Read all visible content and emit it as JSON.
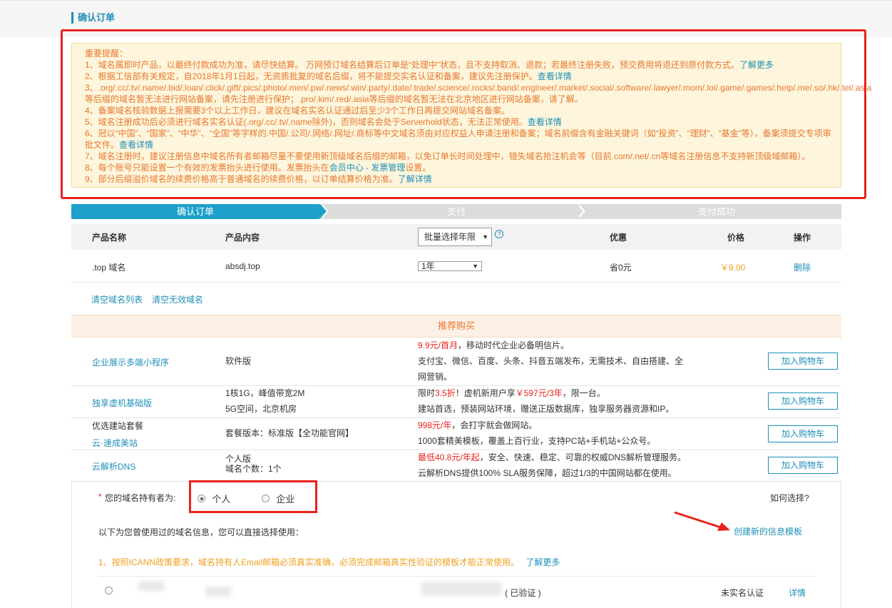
{
  "page": {
    "title": "确认订单"
  },
  "notice": {
    "heading": "重要提醒：",
    "lines": [
      {
        "text": "1、域名属即时产品，以最终付款成功为准，请尽快结算。 万网预订域名结算后订单是“处理中”状态，且不支持取消、退款；若最终注册失败，预交费用将退还到原付款方式。",
        "link": "了解更多"
      },
      {
        "text": "2、根据工信部有关规定，自2018年1月1日起，无资质批复的域名后缀，将不能提交实名认证和备案，建议先注册保护。",
        "link": "查看详情"
      },
      {
        "text": "3、.org/.cc/.tv/.name/.bid/.loan/.click/.gift/.pics/.photo/.men/.pw/.news/.win/.party/.date/.trade/.science/.rocks/.band/.engineer/.market/.social/.software/.lawyer/.mom/.lol/.game/.games/.help/.me/.so/.hk/.tel/.asia等后缀的域名暂无法进行网站备案，请先注册进行保护；.pro/.kim/.red/.asia等后缀的域名暂无法在北京地区进行网站备案，请了解。",
        "link": ""
      },
      {
        "text": "4、备案域名核验数据上报需要3个以上工作日，建议在域名实名认证通过后至少3个工作日再提交网站域名备案。",
        "link": ""
      },
      {
        "text": "5、域名注册成功后必须进行域名实名认证(.org/.cc/.tv/.name除外)，否则域名会处于Serverhold状态，无法正常使用。",
        "link": "查看详情"
      },
      {
        "text": "6、冠以“中国”、“国家”、“中华”、“全国”等字样的.中国/.公司/.网络/.网址/.商标等中文域名须由对应权益人申请注册和备案；域名前缀含有金融关键词（如“投资”、“理财”、“基金”等），备案须提交专项审批文件。",
        "link": "查看详情"
      },
      {
        "text": "7、域名注册时，建议注册信息中域名所有者邮箱尽量不要使用新顶级域名后缀的邮箱，以免订单长时间处理中，错失域名抢注机会等（目前.com/.net/.cn等域名注册信息不支持新顶级域邮箱）。",
        "link": ""
      },
      {
        "text": "8、每个账号只能设置一个有效的发票抬头进行使用。发票抬头在",
        "link": "会员中心 - 发票管理",
        "suffix": "设置。"
      },
      {
        "text": "9、部分后缀溢价域名的续费价格高于普通域名的续费价格，以订单结算价格为准。",
        "link": "了解详情"
      }
    ]
  },
  "steps": [
    "确认订单",
    "支付",
    "支付成功"
  ],
  "table": {
    "headers": {
      "name": "产品名称",
      "content": "产品内容",
      "batch_select": "批量选择年限",
      "discount": "优惠",
      "price": "价格",
      "action": "操作"
    },
    "help_icon": "?",
    "row": {
      "name": ".top 域名",
      "content": "absdj.top",
      "years": "1年",
      "discount": "省0元",
      "price": "￥9.00",
      "action": "删除"
    }
  },
  "links": {
    "clear_list": "清空域名列表",
    "clear_invalid": "清空无效域名"
  },
  "recommend": {
    "title": "推荐购买",
    "cart_label": "加入购物车",
    "items": [
      {
        "name": "企业展示多端小程序",
        "type1": "软件版",
        "type2": "",
        "red": "9.9元/首月",
        "desc1": "，移动时代企业必备明信片。",
        "desc2": "支付宝、微信、百度、头条、抖音五端发布，无需技术、自由搭建、全",
        "desc3": "网营销。"
      },
      {
        "name": "独享虚机基础版",
        "type1": "1核1G，峰值带宽2M",
        "type2": "5G空间，北京机房",
        "pre": "限时",
        "red": "3.5折",
        "mid": "！虚机新用户享",
        "red2": "￥597元/3年",
        "desc1": "，限一台。",
        "desc2": "建站首选，预装网站环境，赠送正版数据库，独享服务器资源和IP。"
      },
      {
        "name_plain": "优选建站套餐",
        "name": "云·速成美站",
        "type1": "套餐版本：标准版【全功能官网】",
        "red": "998元/年",
        "desc1": "，会打字就会做网站。",
        "desc2": "1000套精美模板，覆盖上百行业，支持PC站+手机站+公众号。"
      },
      {
        "name": "云解析DNS",
        "type1": "个人版",
        "type2": "域名个数：1个",
        "red": "最低40.8元/年起",
        "desc1": "，安全、快速、稳定、可靠的权威DNS解析管理服务。",
        "desc2": "云解析DNS提供100% SLA服务保障，超过1/3的中国网站都在使用。"
      }
    ]
  },
  "holder": {
    "asterisk": "*",
    "label": "您的域名持有者为:",
    "options": [
      "个人",
      "企业"
    ],
    "how_to_choose": "如何选择?",
    "history_tip": "以下为您曾使用过的域名信息，您可以直接选择使用：",
    "create_template": "创建新的信息模板",
    "icann_notice": "1、按照ICANN政策要求，域名持有人Email邮箱必须真实准确，必须完成邮箱真实性验证的模板才能正常使用。",
    "icann_link": "了解更多",
    "template_row": {
      "verified": "( 已验证 )",
      "status": "未实名认证",
      "detail": "详情"
    }
  }
}
